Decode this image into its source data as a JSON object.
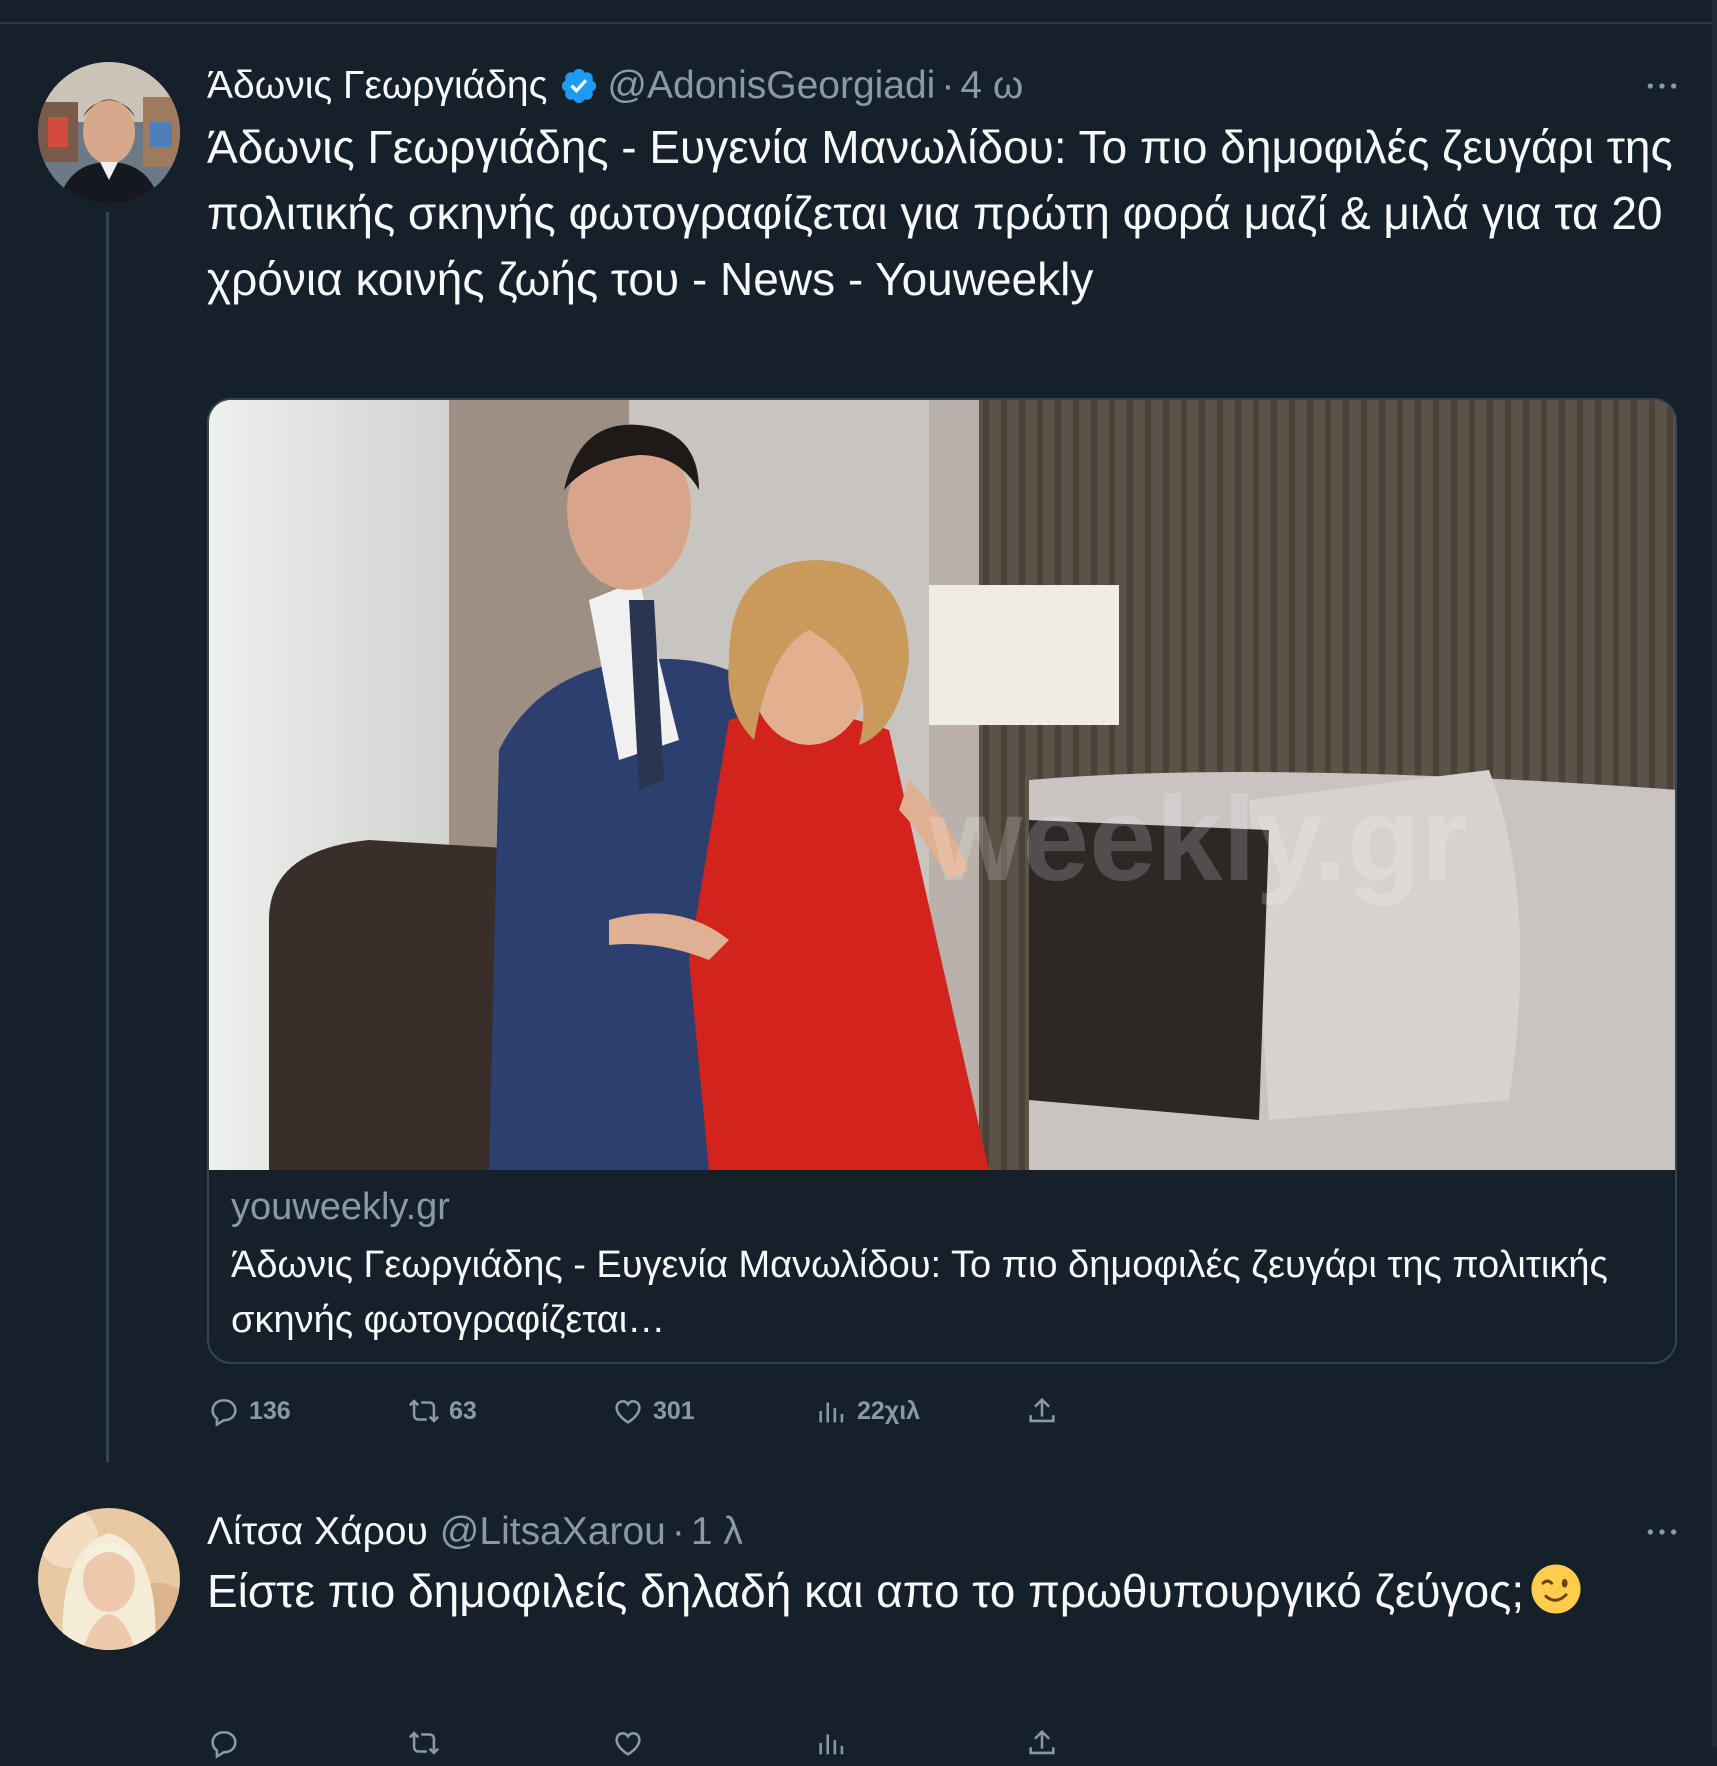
{
  "tweets": [
    {
      "author": {
        "display_name": "Άδωνις Γεωργιάδης",
        "verified": true,
        "handle": "@AdonisGeorgiadi",
        "separator": "·",
        "time": "4 ω"
      },
      "text": "Άδωνις Γεωργιάδης - Ευγενία Μανωλίδου: Το πιο δημοφιλές ζευγάρι της πολιτικής σκηνής φωτογραφίζεται για πρώτη φορά μαζί & μιλά για τα 20 χρόνια κοινής ζωής του - News - Youweekly",
      "card": {
        "domain": "youweekly.gr",
        "title": "Άδωνις Γεωργιάδης - Ευγενία Μανωλίδου: Το πιο δημοφιλές ζευγάρι της πολιτικής σκηνής φωτογραφίζεται…",
        "watermark": "weekly.gr"
      },
      "actions": {
        "replies": "136",
        "retweets": "63",
        "likes": "301",
        "views": "22χιλ"
      }
    },
    {
      "author": {
        "display_name": "Λίτσα Χάρου",
        "verified": false,
        "handle": "@LitsaXarou",
        "separator": "·",
        "time": "1 λ"
      },
      "text": "Είστε πιο δημοφιλείς δηλαδή και απο το πρωθυπουργικό ζεύγος;",
      "emoji": "winking-face",
      "actions": {
        "replies": "",
        "retweets": "",
        "likes": "",
        "views": ""
      }
    }
  ],
  "colors": {
    "background": "#15202b",
    "text_primary": "#f7f9f9",
    "text_secondary": "#8b98a5",
    "border": "#38444d",
    "verified_blue": "#1d9bf0"
  },
  "icons": [
    "more-icon",
    "verified-badge-icon",
    "reply-icon",
    "retweet-icon",
    "like-icon",
    "views-icon",
    "share-icon"
  ]
}
